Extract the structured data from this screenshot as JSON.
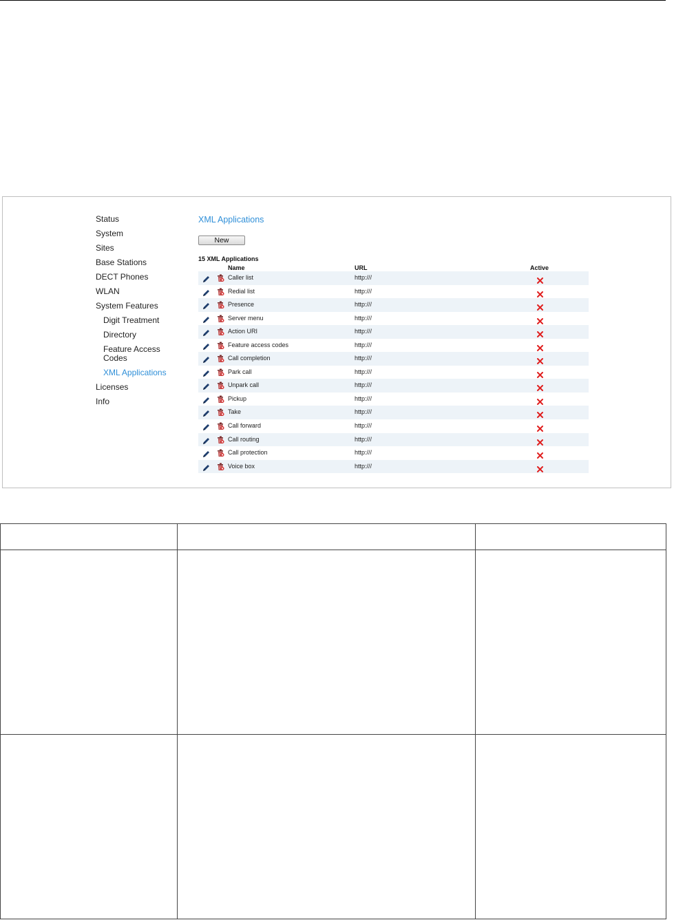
{
  "colors": {
    "link": "#2f8fd8",
    "row_alt": "#edf3f8",
    "inactive_x": "#e02020"
  },
  "nav": {
    "items": [
      {
        "label": "Status",
        "level": 0,
        "active": false
      },
      {
        "label": "System",
        "level": 0,
        "active": false
      },
      {
        "label": "Sites",
        "level": 0,
        "active": false
      },
      {
        "label": "Base Stations",
        "level": 0,
        "active": false
      },
      {
        "label": "DECT Phones",
        "level": 0,
        "active": false
      },
      {
        "label": "WLAN",
        "level": 0,
        "active": false
      },
      {
        "label": "System Features",
        "level": 0,
        "active": false
      },
      {
        "label": "Digit Treatment",
        "level": 1,
        "active": false
      },
      {
        "label": "Directory",
        "level": 1,
        "active": false
      },
      {
        "label": "Feature Access Codes",
        "level": 1,
        "active": false
      },
      {
        "label": "XML Applications",
        "level": 1,
        "active": true
      },
      {
        "label": "Licenses",
        "level": 0,
        "active": false
      },
      {
        "label": "Info",
        "level": 0,
        "active": false
      }
    ]
  },
  "main": {
    "title": "XML Applications",
    "new_button": "New",
    "count_label": "15 XML Applications",
    "columns": {
      "name": "Name",
      "url": "URL",
      "active": "Active"
    },
    "rows": [
      {
        "name": "Caller list",
        "url": "http:///",
        "active": false
      },
      {
        "name": "Redial list",
        "url": "http:///",
        "active": false
      },
      {
        "name": "Presence",
        "url": "http:///",
        "active": false
      },
      {
        "name": "Server menu",
        "url": "http:///",
        "active": false
      },
      {
        "name": "Action URI",
        "url": "http:///",
        "active": false
      },
      {
        "name": "Feature access codes",
        "url": "http:///",
        "active": false
      },
      {
        "name": "Call completion",
        "url": "http:///",
        "active": false
      },
      {
        "name": "Park call",
        "url": "http:///",
        "active": false
      },
      {
        "name": "Unpark call",
        "url": "http:///",
        "active": false
      },
      {
        "name": "Pickup",
        "url": "http:///",
        "active": false
      },
      {
        "name": "Take",
        "url": "http:///",
        "active": false
      },
      {
        "name": "Call forward",
        "url": "http:///",
        "active": false
      },
      {
        "name": "Call routing",
        "url": "http:///",
        "active": false
      },
      {
        "name": "Call protection",
        "url": "http:///",
        "active": false
      },
      {
        "name": "Voice box",
        "url": "http:///",
        "active": false
      }
    ]
  }
}
